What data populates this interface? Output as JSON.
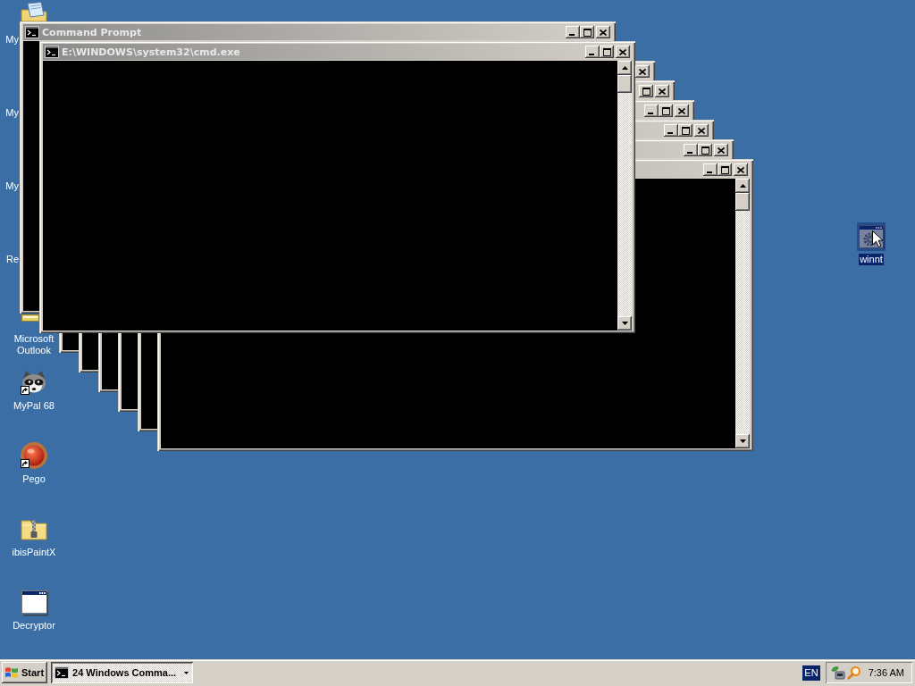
{
  "desktop": {
    "icons": [
      {
        "label": "My",
        "kind": "covered",
        "selected": false
      },
      {
        "label": "My",
        "kind": "covered",
        "selected": false
      },
      {
        "label": "My",
        "kind": "covered",
        "selected": false
      },
      {
        "label": "Re",
        "kind": "covered",
        "selected": false
      },
      {
        "label": "Microsoft Outlook",
        "kind": "partial",
        "selected": false
      },
      {
        "label": "MyPal 68",
        "kind": "icon",
        "selected": false,
        "shortcut": true
      },
      {
        "label": "Pego",
        "kind": "icon",
        "selected": false,
        "shortcut": true
      },
      {
        "label": "ibisPaintX",
        "kind": "icon",
        "selected": false,
        "shortcut": false
      },
      {
        "label": "Decryptor",
        "kind": "icon",
        "selected": false,
        "shortcut": false
      }
    ],
    "loose_icons": [
      {
        "label": "winnt",
        "selected": true
      }
    ]
  },
  "windows": [
    {
      "kind": "back",
      "active": false,
      "title": "Command Prompt"
    },
    {
      "kind": "front",
      "active": false,
      "title": "E:\\WINDOWS\\system32\\cmd.exe"
    },
    {
      "kind": "cascade",
      "active": false
    },
    {
      "kind": "cascade",
      "active": false
    },
    {
      "kind": "cascade",
      "active": false
    },
    {
      "kind": "cascade",
      "active": false
    },
    {
      "kind": "cascade",
      "active": false
    },
    {
      "kind": "cascadetop",
      "active": false
    }
  ],
  "taskbar": {
    "start_button": "Start",
    "buttons": [
      {
        "label": "24 Windows Comma...",
        "selected": true
      }
    ],
    "language": "EN",
    "clock": "7:36 AM"
  }
}
